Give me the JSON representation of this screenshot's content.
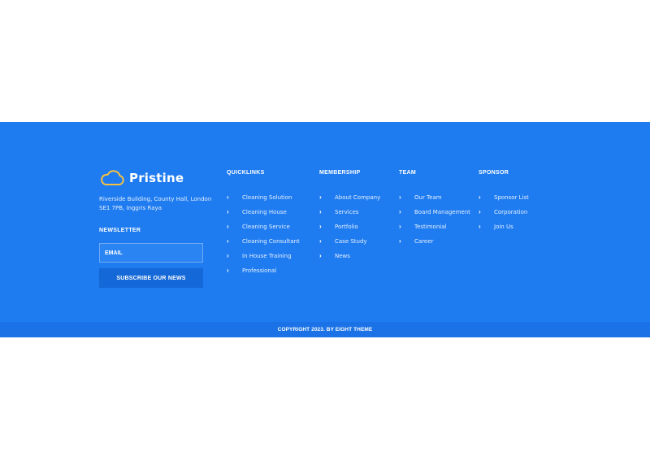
{
  "brand": {
    "name": "Pristine",
    "icon": "cloud-icon",
    "icon_color": "#f5c242"
  },
  "address": "Riverside Building, County Hall, London SE1 7PB, Inggris Raya",
  "newsletter": {
    "title": "NEWSLETTER",
    "email_placeholder": "EMAIL",
    "button_label": "SUBSCRIBE OUR NEWS"
  },
  "columns": [
    {
      "title": "QUICKLINKS",
      "links": [
        "Cleaning Solution",
        "Cleaning House",
        "Cleaning Service",
        "Cleaning Consultant",
        "In House Training",
        "Professional"
      ]
    },
    {
      "title": "MEMBERSHIP",
      "links": [
        "About Company",
        "Services",
        "Portfolio",
        "Case Study",
        "News"
      ]
    },
    {
      "title": "TEAM",
      "links": [
        "Our Team",
        "Board Management",
        "Testimonial",
        "Career"
      ]
    },
    {
      "title": "SPONSOR",
      "links": [
        "Sponsor List",
        "Corporation",
        "Join Us"
      ]
    }
  ],
  "copyright": "COPYRIGHT 2023. BY EIGHT THEME",
  "colors": {
    "footer_bg": "#1f7cf0",
    "bottom_bar_bg": "#1a72e6",
    "button_bg": "#1468d8"
  }
}
